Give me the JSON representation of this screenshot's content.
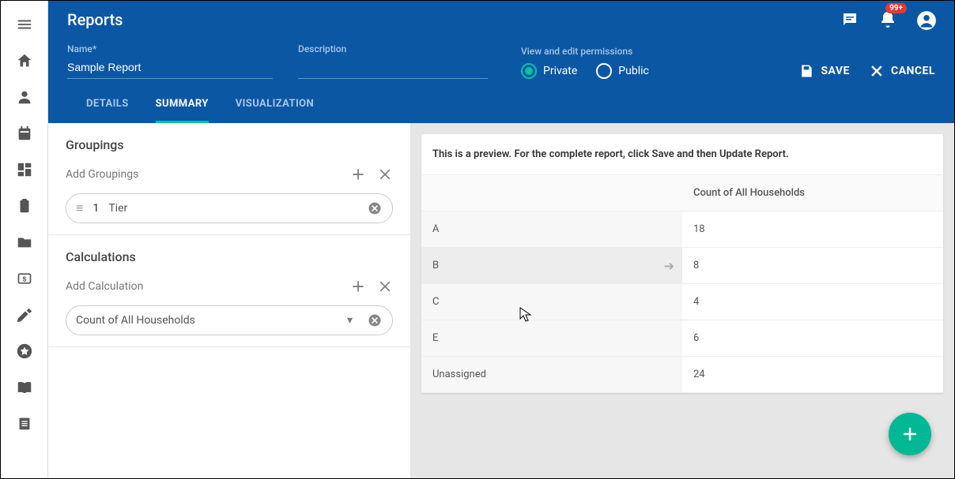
{
  "header": {
    "title": "Reports",
    "notif_badge": "99+"
  },
  "form": {
    "name_label": "Name*",
    "name_value": "Sample Report",
    "desc_label": "Description",
    "desc_value": "",
    "perm_label": "View and edit permissions",
    "perm_private": "Private",
    "perm_public": "Public",
    "save_label": "SAVE",
    "cancel_label": "CANCEL"
  },
  "tabs": {
    "details": "DETAILS",
    "summary": "SUMMARY",
    "visualization": "VISUALIZATION"
  },
  "groupings": {
    "title": "Groupings",
    "add_label": "Add Groupings",
    "item_number": "1",
    "item_label": "Tier"
  },
  "calculations": {
    "title": "Calculations",
    "add_label": "Add Calculation",
    "item_label": "Count of All Households"
  },
  "preview": {
    "notice": "This is a preview. For the complete report, click Save and then Update Report.",
    "col_header": "Count of All Households",
    "rows": [
      {
        "cat": "A",
        "val": "18"
      },
      {
        "cat": "B",
        "val": "8"
      },
      {
        "cat": "C",
        "val": "4"
      },
      {
        "cat": "E",
        "val": "6"
      },
      {
        "cat": "Unassigned",
        "val": "24"
      }
    ]
  }
}
